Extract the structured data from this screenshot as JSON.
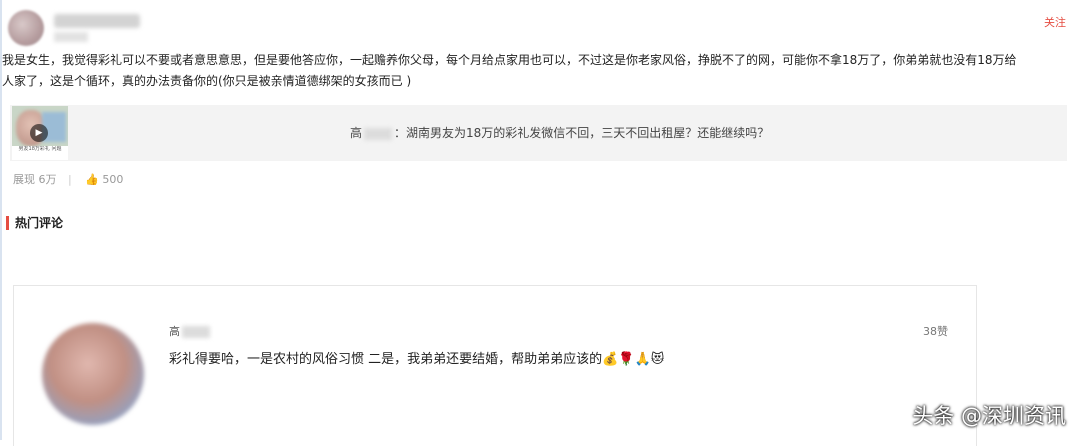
{
  "header": {
    "follow_label": "关注"
  },
  "post": {
    "line1": "我是女生，我觉得彩礼可以不要或者意思意思，但是要他答应你，一起赡养你父母，每个月给点家用也可以，不过这是你老家风俗，挣脱不了的网，可能你不拿18万了，你弟弟就也没有18万给",
    "line2": "人家了，这是个循环，真的办法责备你的(你只是被亲情道德绑架的女孩而已 )"
  },
  "link_card": {
    "title_prefix": "高",
    "title_text": "：湖南男友为18万的彩礼发微信不回，三天不回出租屋？还能继续吗？",
    "thumb_caption": "男友18万彩礼 问题"
  },
  "stats": {
    "views": "展现 6万",
    "likes": "500"
  },
  "hot_comments": {
    "heading": "热门评论"
  },
  "comment": {
    "name_prefix": "高",
    "likes": "38赞",
    "text": "彩礼得要哈，一是农村的风俗习惯 二是，我弟弟还要结婚，帮助弟弟应该的💰🌹🙏😻"
  },
  "watermark": "头条 @深圳资讯"
}
